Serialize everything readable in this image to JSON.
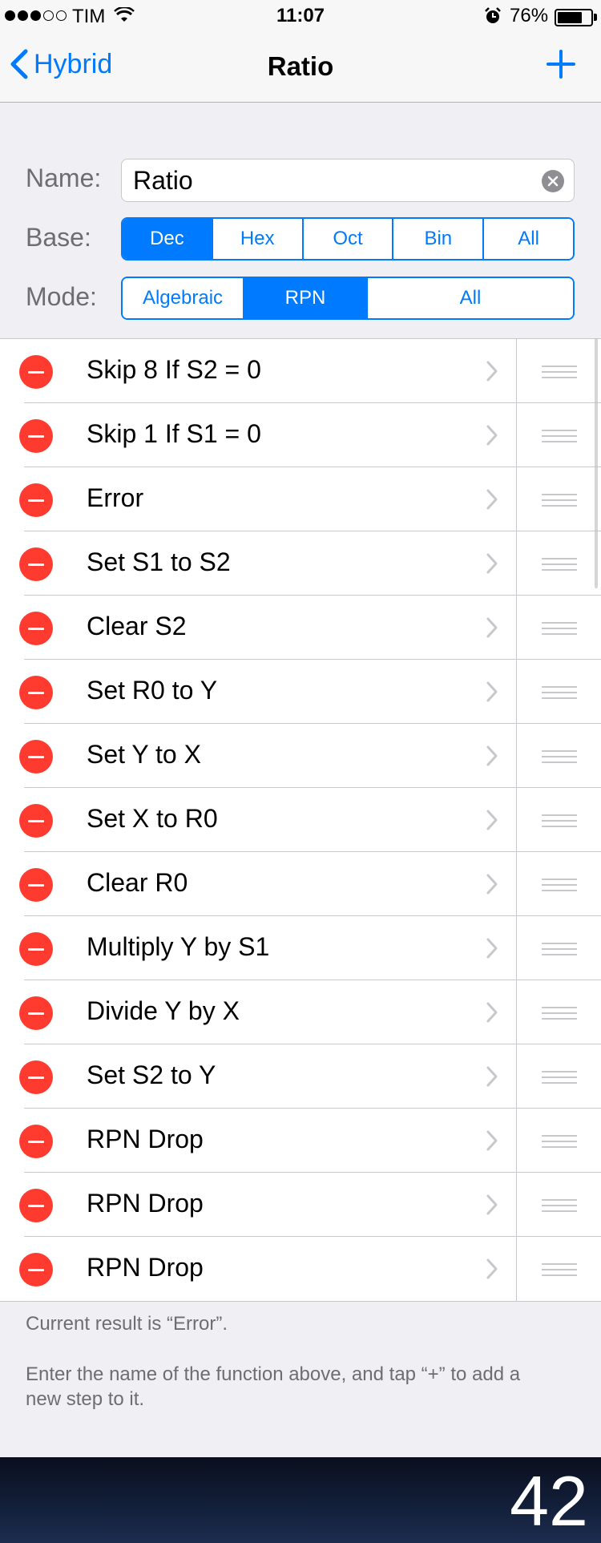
{
  "status_bar": {
    "carrier": "TIM",
    "time": "11:07",
    "battery_percent": "76%",
    "battery_level": 0.76,
    "signal_bars_filled": 3,
    "signal_bars_total": 5
  },
  "nav": {
    "back_label": "Hybrid",
    "title": "Ratio",
    "add_icon": "plus-icon"
  },
  "form": {
    "name_label": "Name:",
    "name_value": "Ratio",
    "base_label": "Base:",
    "base_options": [
      "Dec",
      "Hex",
      "Oct",
      "Bin",
      "All"
    ],
    "base_selected": "Dec",
    "mode_label": "Mode:",
    "mode_options": [
      "Algebraic",
      "RPN",
      "All"
    ],
    "mode_selected": "RPN"
  },
  "steps": [
    "Skip 8 If S2 = 0",
    "Skip 1 If S1 = 0",
    "Error",
    "Set S1 to S2",
    "Clear S2",
    "Set R0 to Y",
    "Set Y to X",
    "Set X to R0",
    "Clear R0",
    "Multiply Y by S1",
    "Divide Y by X",
    "Set S2 to Y",
    "RPN Drop",
    "RPN Drop",
    "RPN Drop"
  ],
  "footer": {
    "result_text": "Current result is “Error”.",
    "hint_text": "Enter the name of the function above, and tap “+” to add a new step to it."
  },
  "display": {
    "value": "42"
  },
  "colors": {
    "accent": "#007aff",
    "delete": "#ff3b30",
    "display_bg": "#13203b"
  }
}
